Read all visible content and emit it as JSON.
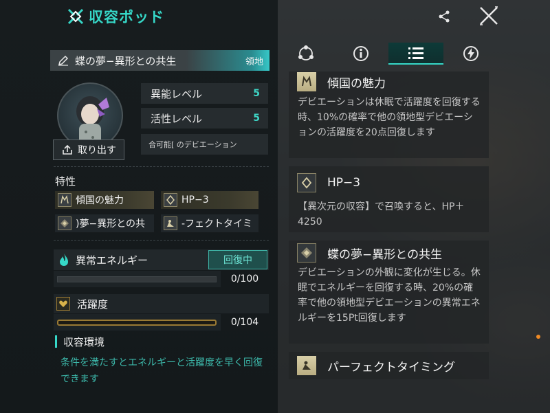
{
  "header": {
    "title": "収容ポッド"
  },
  "abnormality": {
    "name": "蝶の夢−異形との共生",
    "realm_badge": "領地",
    "takeout_label": "取り出す",
    "stats": [
      {
        "label": "異能レベル",
        "value": "5"
      },
      {
        "label": "活性レベル",
        "value": "5"
      }
    ],
    "deviation_text": "合可能[ のデビエーション"
  },
  "traits": {
    "section_label": "特性",
    "items": [
      {
        "label": "傾国の魅力",
        "icon": "charm-icon"
      },
      {
        "label": "HP−3",
        "icon": "hp-diamond-icon"
      },
      {
        "label": ")夢−異形との共",
        "icon": "symbiosis-icon"
      },
      {
        "label": "-フェクトタイミ",
        "icon": "timing-icon"
      }
    ]
  },
  "energy": {
    "label": "異常エネルギー",
    "status": "回復中",
    "count": "0/100",
    "progress": 0
  },
  "activity": {
    "label": "活躍度",
    "count": "0/104",
    "progress": 0
  },
  "environment": {
    "title": "収容環境",
    "desc": "条件を満たすとエネルギーと活躍度を早く回復できます"
  },
  "tabs": [
    {
      "name": "network-icon"
    },
    {
      "name": "info-icon"
    },
    {
      "name": "list-icon",
      "active": true
    },
    {
      "name": "bolt-icon"
    }
  ],
  "cards": [
    {
      "title": "傾国の魅力",
      "text": "デビエーションは休眠で活躍度を回復する時、10%の確率で他の領地型デビエーションの活躍度を20点回復します"
    },
    {
      "title": "HP−3",
      "text": "【異次元の収容】で召喚すると、HP＋4250"
    },
    {
      "title": "蝶の夢−異形との共生",
      "text": "デビエーションの外観に変化が生じる。休眠でエネルギーを回復する時、20%の確率で他の領地型デビエーションの異常エネルギーを15Pt回復します"
    },
    {
      "title": "パーフェクトタイミング",
      "text": ""
    }
  ],
  "colors": {
    "accent": "#36d8c8",
    "gold": "#9a7a34",
    "status_teal": "#1f4f4c"
  }
}
